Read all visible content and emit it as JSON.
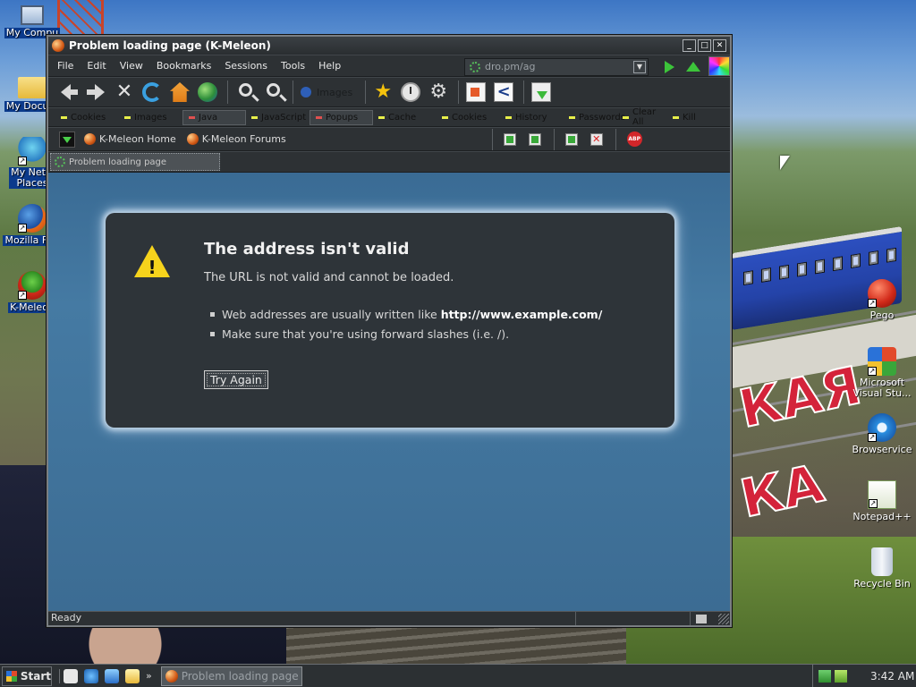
{
  "desktop": {
    "icons_left": [
      {
        "label": "My Compu",
        "icon": "my-computer-icon"
      },
      {
        "label": "My Docum",
        "icon": "my-documents-icon"
      },
      {
        "label": "My Netw\nPlaces",
        "icon": "network-places-icon"
      },
      {
        "label": "Mozilla Fire",
        "icon": "firefox-icon"
      },
      {
        "label": "K-Meleon",
        "icon": "kmeleon-icon"
      }
    ],
    "icons_right": [
      {
        "label": "Pego",
        "icon": "pego-icon"
      },
      {
        "label": "Microsoft Visual Stu...",
        "icon": "visual-studio-icon"
      },
      {
        "label": "Browservice",
        "icon": "ie-icon"
      },
      {
        "label": "Notepad++",
        "icon": "notepadpp-icon"
      },
      {
        "label": "Recycle Bin",
        "icon": "recycle-bin-icon"
      }
    ],
    "wallpaper_text": [
      "КАЯ",
      "КА"
    ]
  },
  "window": {
    "title": "Problem loading page (K-Meleon)",
    "menu": [
      "File",
      "Edit",
      "View",
      "Bookmarks",
      "Sessions",
      "Tools",
      "Help"
    ],
    "url": "dro.pm/ag",
    "images_label": "Images",
    "toggles": [
      {
        "label": "Cookies",
        "state": "on"
      },
      {
        "label": "Images",
        "state": "on"
      },
      {
        "label": "Java",
        "state": "off"
      },
      {
        "label": "JavaScript",
        "state": "on"
      },
      {
        "label": "Popups",
        "state": "off"
      },
      {
        "label": "Cache",
        "state": "on"
      },
      {
        "label": "Cookies",
        "state": "on"
      },
      {
        "label": "History",
        "state": "on"
      },
      {
        "label": "Passwords",
        "state": "on"
      },
      {
        "label": "Clear All",
        "state": "on"
      },
      {
        "label": "Kill Fla",
        "state": "on"
      }
    ],
    "links": [
      "K-Meleon Home",
      "K-Meleon Forums"
    ],
    "abp_label": "ABP",
    "tab_label": "Problem loading page",
    "status": "Ready"
  },
  "error_page": {
    "title": "The address isn't valid",
    "description": "The URL is not valid and cannot be loaded.",
    "bullets": [
      {
        "text": "Web addresses are usually written like",
        "bold": "http://www.example.com/"
      },
      {
        "text": "Make sure that you're using forward slashes (i.e. /).",
        "bold": ""
      }
    ],
    "button": "Try Again"
  },
  "taskbar": {
    "start_label": "Start",
    "task": "Problem loading page ...",
    "clock": "3:42 AM",
    "overflow_glyph": "»"
  },
  "colors": {
    "content_bg": "#3f6f96",
    "error_box_bg": "#2e3439",
    "warning": "#f6d31c",
    "chrome": "#2d3134"
  }
}
